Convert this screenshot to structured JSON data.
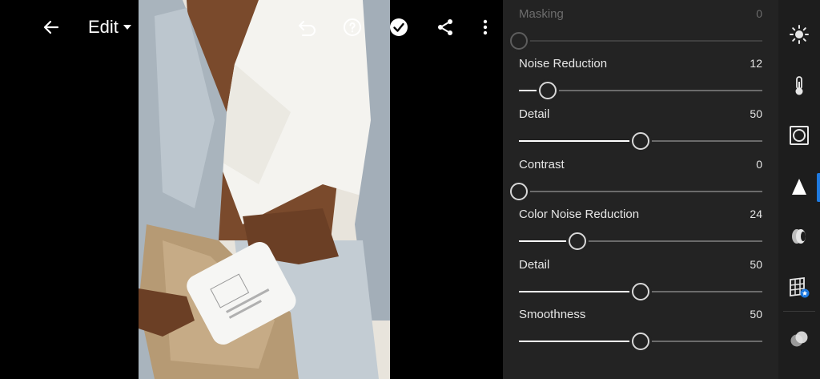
{
  "toolbar": {
    "mode_label": "Edit",
    "icons": [
      "back-arrow-icon",
      "chevron-down-icon",
      "undo-icon",
      "help-icon",
      "checkmark-icon",
      "share-icon",
      "more-vertical-icon"
    ]
  },
  "detail_panel": {
    "sliders": [
      {
        "label": "Masking",
        "value": "0",
        "fraction": 0.0,
        "enabled": false
      },
      {
        "label": "Noise Reduction",
        "value": "12",
        "fraction": 0.12,
        "enabled": true
      },
      {
        "label": "Detail",
        "value": "50",
        "fraction": 0.5,
        "enabled": true
      },
      {
        "label": "Contrast",
        "value": "0",
        "fraction": 0.0,
        "enabled": true
      },
      {
        "label": "Color Noise Reduction",
        "value": "24",
        "fraction": 0.24,
        "enabled": true
      },
      {
        "label": "Detail",
        "value": "50",
        "fraction": 0.5,
        "enabled": true
      },
      {
        "label": "Smoothness",
        "value": "50",
        "fraction": 0.5,
        "enabled": true
      }
    ]
  },
  "rail": {
    "items": [
      "light-icon",
      "color-temperature-icon",
      "effects-icon",
      "detail-icon",
      "optics-icon",
      "geometry-icon",
      "presets-icon"
    ],
    "active": "detail-icon"
  },
  "colors": {
    "accent": "#1f7ae0",
    "panel_bg": "#232323",
    "rail_bg": "#1d1d1d"
  }
}
